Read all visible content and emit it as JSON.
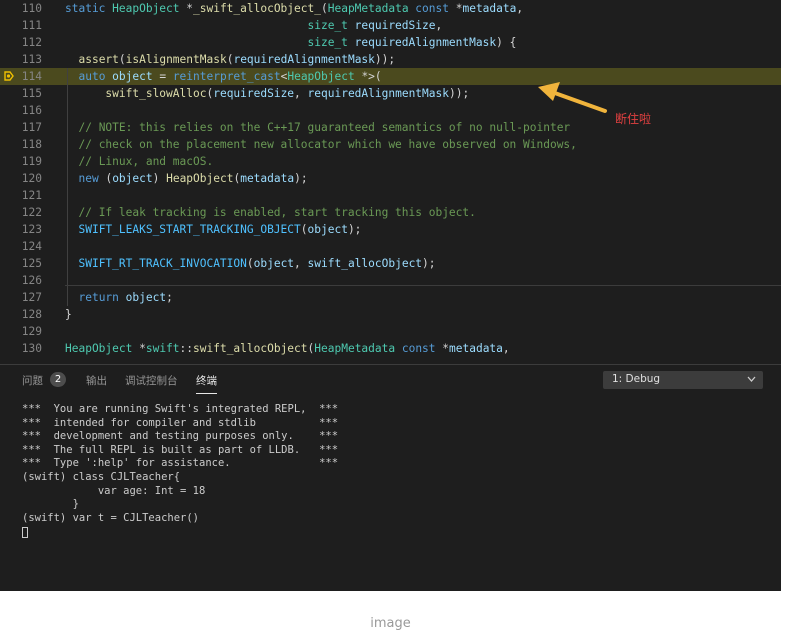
{
  "editor": {
    "lines": [
      {
        "num": "110",
        "segs": [
          [
            "k",
            "static "
          ],
          [
            "t",
            "HeapObject "
          ],
          [
            "",
            "*"
          ],
          [
            "f",
            "_swift_allocObject_"
          ],
          [
            "",
            "("
          ],
          [
            "t",
            "HeapMetadata "
          ],
          [
            "k",
            "const "
          ],
          [
            "",
            "*"
          ],
          [
            "v",
            "metadata"
          ],
          [
            "",
            ","
          ]
        ]
      },
      {
        "num": "111",
        "segs": [
          [
            "",
            "                                    "
          ],
          [
            "t",
            "size_t "
          ],
          [
            "v",
            "requiredSize"
          ],
          [
            "",
            ","
          ]
        ]
      },
      {
        "num": "112",
        "segs": [
          [
            "",
            "                                    "
          ],
          [
            "t",
            "size_t "
          ],
          [
            "v",
            "requiredAlignmentMask"
          ],
          [
            "",
            ") {"
          ]
        ]
      },
      {
        "num": "113",
        "segs": [
          [
            "",
            "  "
          ],
          [
            "f",
            "assert"
          ],
          [
            "",
            "("
          ],
          [
            "f",
            "isAlignmentMask"
          ],
          [
            "",
            "("
          ],
          [
            "v",
            "requiredAlignmentMask"
          ],
          [
            "",
            "));"
          ]
        ]
      },
      {
        "num": "114",
        "segs": [
          [
            "",
            "  "
          ],
          [
            "k",
            "auto "
          ],
          [
            "v",
            "object "
          ],
          [
            "",
            "= "
          ],
          [
            "k",
            "reinterpret_cast"
          ],
          [
            "",
            "<"
          ],
          [
            "t",
            "HeapObject "
          ],
          [
            "",
            "*>("
          ]
        ]
      },
      {
        "num": "115",
        "segs": [
          [
            "",
            "      "
          ],
          [
            "f",
            "swift_slowAlloc"
          ],
          [
            "",
            "("
          ],
          [
            "v",
            "requiredSize"
          ],
          [
            "",
            ", "
          ],
          [
            "v",
            "requiredAlignmentMask"
          ],
          [
            "",
            "));"
          ]
        ]
      },
      {
        "num": "116",
        "segs": []
      },
      {
        "num": "117",
        "segs": [
          [
            "",
            "  "
          ],
          [
            "c",
            "// NOTE: this relies on the C++17 guaranteed semantics of no null-pointer"
          ]
        ]
      },
      {
        "num": "118",
        "segs": [
          [
            "",
            "  "
          ],
          [
            "c",
            "// check on the placement new allocator which we have observed on Windows,"
          ]
        ]
      },
      {
        "num": "119",
        "segs": [
          [
            "",
            "  "
          ],
          [
            "c",
            "// Linux, and macOS."
          ]
        ]
      },
      {
        "num": "120",
        "segs": [
          [
            "",
            "  "
          ],
          [
            "k",
            "new "
          ],
          [
            "",
            "("
          ],
          [
            "v",
            "object"
          ],
          [
            "",
            ") "
          ],
          [
            "f",
            "HeapObject"
          ],
          [
            "",
            "("
          ],
          [
            "v",
            "metadata"
          ],
          [
            "",
            ");"
          ]
        ]
      },
      {
        "num": "121",
        "segs": []
      },
      {
        "num": "122",
        "segs": [
          [
            "",
            "  "
          ],
          [
            "c",
            "// If leak tracking is enabled, start tracking this object."
          ]
        ]
      },
      {
        "num": "123",
        "segs": [
          [
            "",
            "  "
          ],
          [
            "m",
            "SWIFT_LEAKS_START_TRACKING_OBJECT"
          ],
          [
            "",
            "("
          ],
          [
            "v",
            "object"
          ],
          [
            "",
            ");"
          ]
        ]
      },
      {
        "num": "124",
        "segs": []
      },
      {
        "num": "125",
        "segs": [
          [
            "",
            "  "
          ],
          [
            "m",
            "SWIFT_RT_TRACK_INVOCATION"
          ],
          [
            "",
            "("
          ],
          [
            "v",
            "object"
          ],
          [
            "",
            ", "
          ],
          [
            "v",
            "swift_allocObject"
          ],
          [
            "",
            ");"
          ]
        ]
      },
      {
        "num": "126",
        "segs": []
      },
      {
        "num": "127",
        "segs": [
          [
            "",
            "  "
          ],
          [
            "k",
            "return "
          ],
          [
            "v",
            "object"
          ],
          [
            "",
            ";"
          ]
        ]
      },
      {
        "num": "128",
        "segs": [
          [
            "",
            "}"
          ]
        ]
      },
      {
        "num": "129",
        "segs": []
      },
      {
        "num": "130",
        "segs": [
          [
            "t",
            "HeapObject "
          ],
          [
            "",
            "*"
          ],
          [
            "t",
            "swift"
          ],
          [
            "",
            "::"
          ],
          [
            "f",
            "swift_allocObject"
          ],
          [
            "",
            "("
          ],
          [
            "t",
            "HeapMetadata "
          ],
          [
            "k",
            "const "
          ],
          [
            "",
            "*"
          ],
          [
            "v",
            "metadata"
          ],
          [
            "",
            ","
          ]
        ]
      }
    ],
    "annotation": "断住啦",
    "highlight_line": "114"
  },
  "panel": {
    "tabs": [
      "问题",
      "输出",
      "调试控制台",
      "终端"
    ],
    "problems_count": "2",
    "active_tab": "终端",
    "terminal_select": "1: Debug",
    "terminal_lines": [
      "***  You are running Swift's integrated REPL,  ***",
      "***  intended for compiler and stdlib          ***",
      "***  development and testing purposes only.    ***",
      "***  The full REPL is built as part of LLDB.   ***",
      "***  Type ':help' for assistance.              ***",
      "(swift) class CJLTeacher{",
      "            var age: Int = 18",
      "        }",
      "(swift) var t = CJLTeacher()"
    ]
  },
  "caption": "image",
  "colors": {
    "highlight": "#4b4a1e",
    "annotation": "#e04040",
    "arrow": "#f0b43c",
    "background": "#1e1e1e"
  }
}
